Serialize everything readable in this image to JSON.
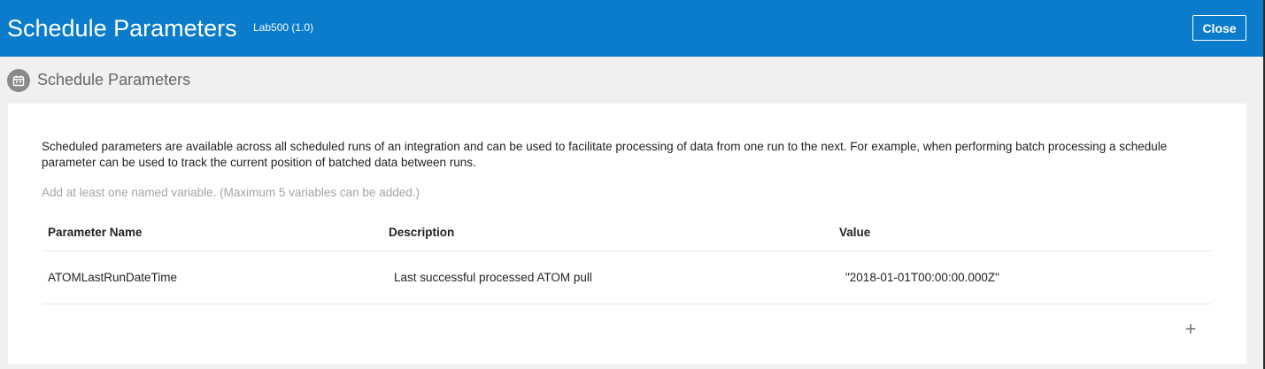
{
  "header": {
    "title": "Schedule Parameters",
    "version": "Lab500 (1.0)",
    "close_label": "Close",
    "background": "#0a7ccb"
  },
  "section": {
    "icon": "calendar-icon",
    "title": "Schedule Parameters"
  },
  "panel": {
    "description": "Scheduled parameters are available across all scheduled runs of an integration and can be used to facilitate processing of data from one run to the next. For example, when performing batch processing a schedule parameter can be used to track the current position of batched data between runs.",
    "hint": "Add at least one named variable. (Maximum 5 variables can be added.)"
  },
  "table": {
    "columns": [
      "Parameter Name",
      "Description",
      "Value"
    ],
    "rows": [
      {
        "name": "ATOMLastRunDateTime",
        "description": "Last successful processed ATOM pull",
        "value": "\"2018-01-01T00:00:00.000Z\""
      }
    ]
  },
  "add_button": {
    "icon": "plus-icon",
    "label": "+"
  }
}
